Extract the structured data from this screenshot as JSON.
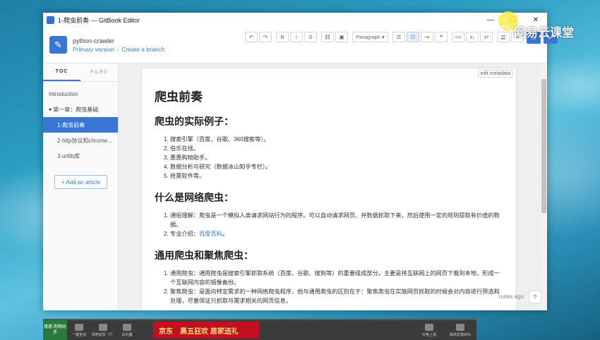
{
  "window": {
    "title": "1-爬虫前奏 — GitBook Editor",
    "controls": {
      "minimize": "—",
      "maximize": "☐",
      "close": "✕"
    }
  },
  "header": {
    "edit_icon": "pencil-icon",
    "book_name": "python-crawler",
    "version_link": "Primary version",
    "branch_link": "Create a branch"
  },
  "toolbar": {
    "undo": "↶",
    "redo": "↷",
    "bold": "B",
    "italic": "i",
    "strike": "S",
    "link": "⛓",
    "image": "▣",
    "paragraph": "Paragraph ▾",
    "ul": "☰",
    "ol": "☷",
    "indent": "⇥",
    "quote": "❝",
    "code": "<>",
    "sub": "x₂",
    "sup": "x²",
    "table": "▦",
    "hr": "═",
    "preview": "▭",
    "save": "✓"
  },
  "sidebar": {
    "tabs": [
      {
        "label": "TOC"
      },
      {
        "label": "FILES"
      }
    ],
    "items": [
      {
        "label": "Introduction"
      },
      {
        "label": "▾ 第一章：爬虫基础"
      },
      {
        "label": "1-爬虫前奏"
      },
      {
        "label": "2-http协议和chrome..."
      },
      {
        "label": "3-urllib库"
      }
    ],
    "add_article": "+ Add an article"
  },
  "editor": {
    "edit_metadata": "edit metadata",
    "title": "爬虫前奏",
    "section1": {
      "heading": "爬虫的实际例子：",
      "items": [
        "搜索引擎（百度、谷歌、360搜索等）。",
        "伯乐在线。",
        "惠惠购物助手。",
        "数据分析与研究（数据冰山知乎专栏）。",
        "抢票软件等。"
      ]
    },
    "section2": {
      "heading": "什么是网络爬虫：",
      "items": [
        "通俗理解：爬虫是一个模拟人类请求网站行为的程序。可以自动请求网页、并数据抓取下来，然后使用一定的规则提取有价值的数据。",
        "专业介绍："
      ],
      "link": "百度百科",
      "link_suffix": "。"
    },
    "section3": {
      "heading": "通用爬虫和聚焦爬虫：",
      "items": [
        "通用爬虫：通用爬虫是搜索引擎抓取系统（百度、谷歌、搜狗等）的重要组成部分。主要是将互联网上的网页下载到本地，形成一个互联网内容的镜像备份。",
        "聚焦爬虫：是面向特定需求的一种网络爬虫程序，他与通用爬虫的区别在于：聚焦爬虫在实施网页抓取的时候会对内容进行筛选和处理，尽量保证只抓取与需求相关的网页信息。"
      ]
    },
    "status": "nutes ago",
    "help": "?"
  },
  "watermark": "网易云课堂",
  "taskbar": {
    "logo": "惠惠 购物助手",
    "items": [
      "一键查询",
      "领券返现（7）",
      "比价器"
    ],
    "ad": [
      "京东",
      "黑五狂欢 居家送礼"
    ],
    "right": [
      "价格上涨",
      "最高优惠89%"
    ]
  }
}
